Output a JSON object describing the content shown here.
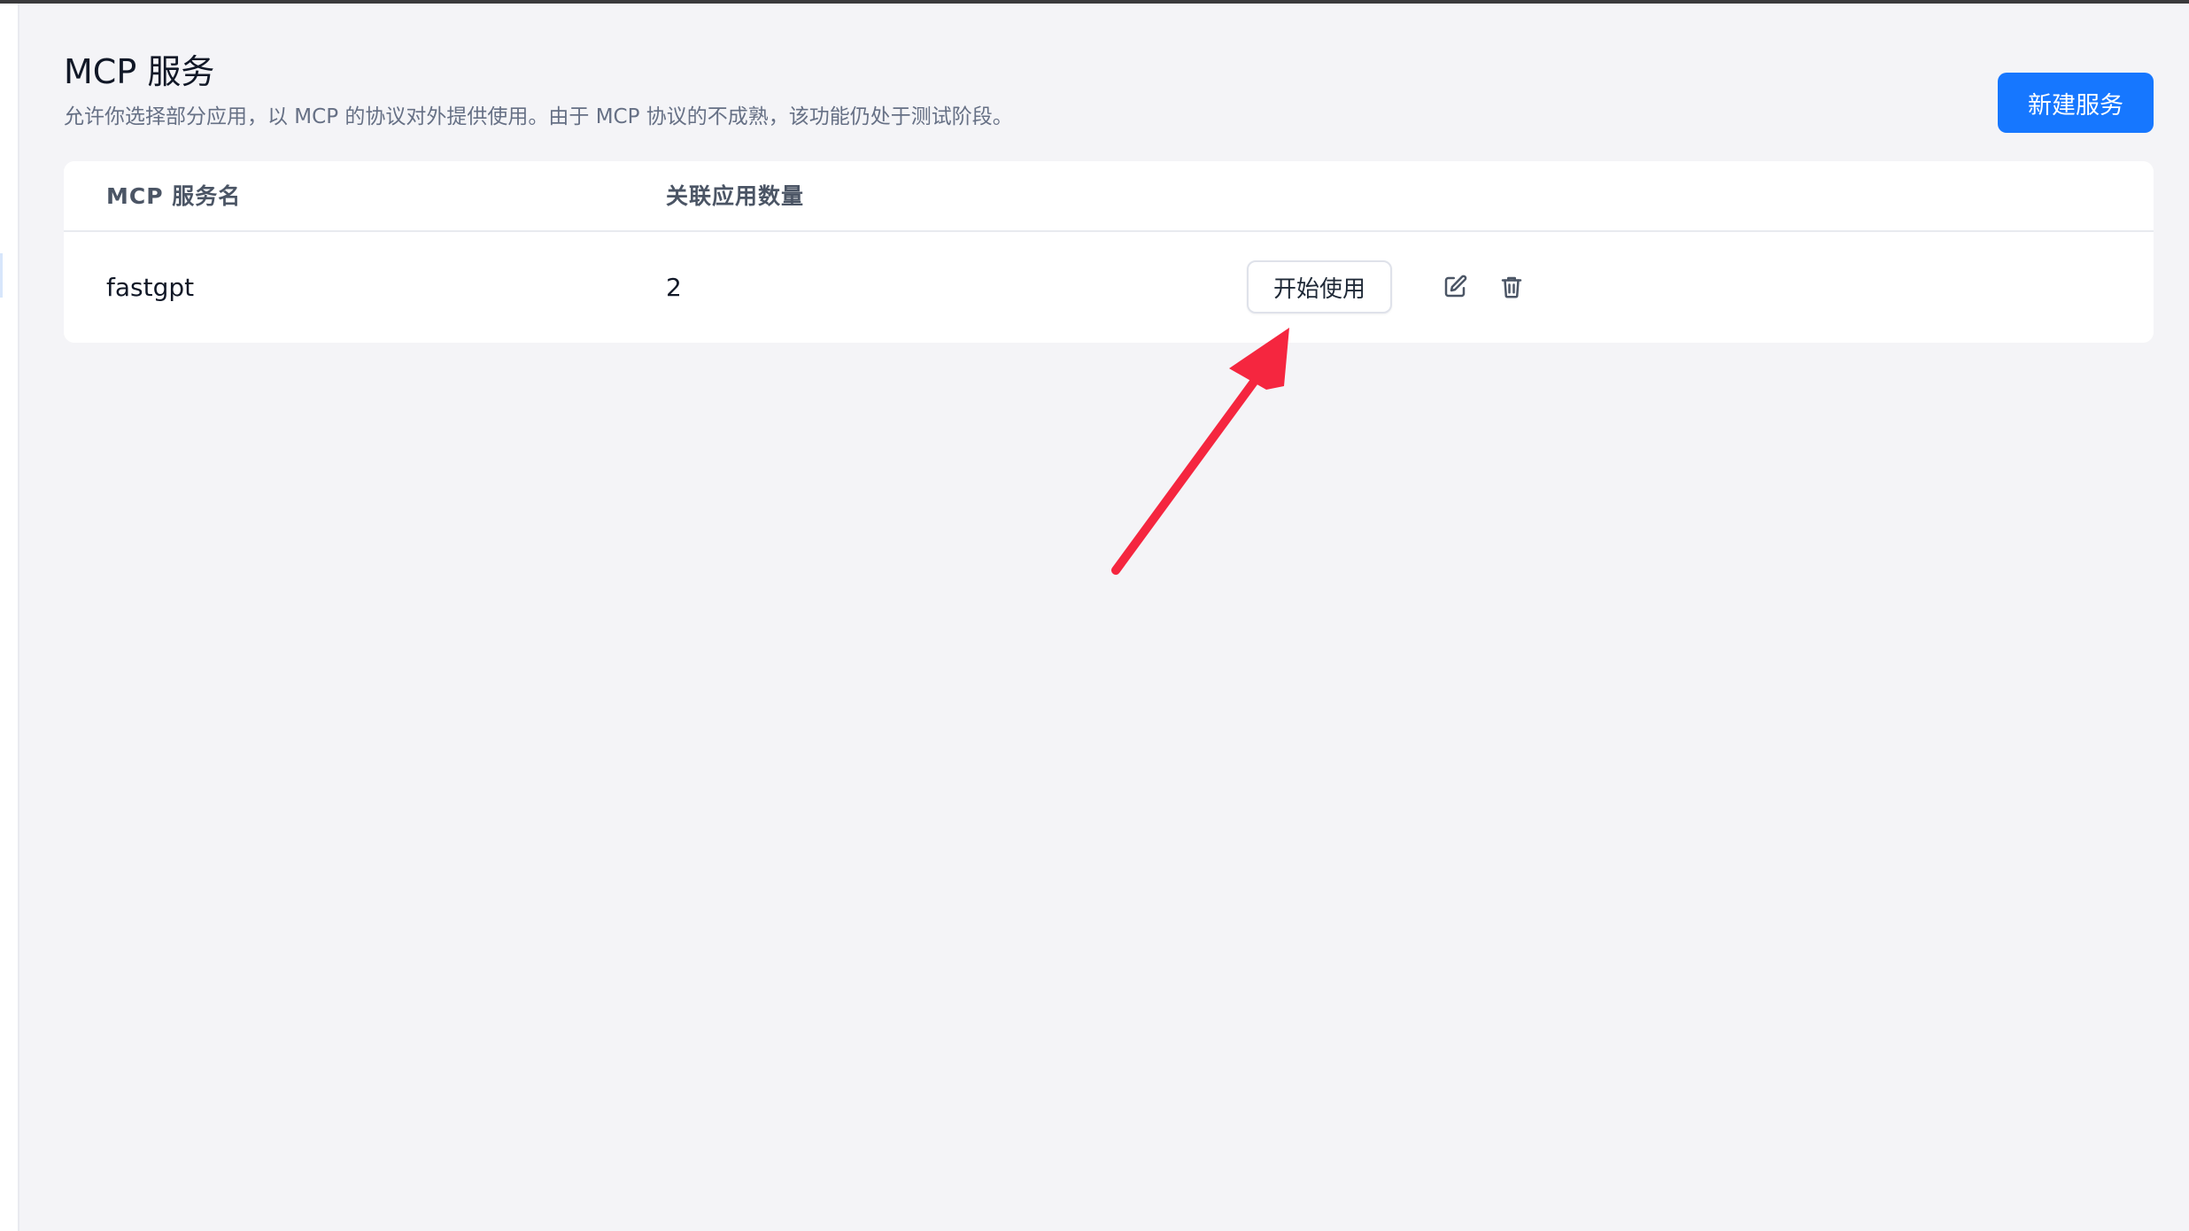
{
  "header": {
    "title": "MCP 服务",
    "description": "允许你选择部分应用，以 MCP 的协议对外提供使用。由于 MCP 协议的不成熟，该功能仍处于测试阶段。",
    "new_button_label": "新建服务"
  },
  "table": {
    "columns": [
      "MCP 服务名",
      "关联应用数量"
    ],
    "rows": [
      {
        "name": "fastgpt",
        "app_count": "2",
        "start_label": "开始使用",
        "edit_icon": "edit-icon",
        "delete_icon": "trash-icon"
      }
    ]
  },
  "colors": {
    "accent": "#1677ff",
    "background": "#f4f4f7",
    "annotation_arrow": "#f5263f"
  }
}
